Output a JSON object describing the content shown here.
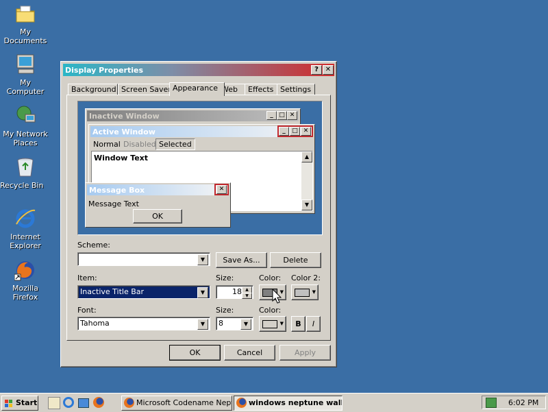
{
  "desktop": {
    "icons": [
      {
        "label": "My Documents"
      },
      {
        "label": "My Computer"
      },
      {
        "label": "My Network Places"
      },
      {
        "label": "Recycle Bin"
      },
      {
        "label": "Internet Explorer"
      },
      {
        "label": "Mozilla Firefox"
      }
    ]
  },
  "dialog": {
    "title": "Display Properties",
    "help_btn": "?",
    "close_btn": "✕",
    "tabs": [
      "Background",
      "Screen Saver",
      "Appearance",
      "Web",
      "Effects",
      "Settings"
    ],
    "active_tab": "Appearance",
    "preview": {
      "inactive_title": "Inactive Window",
      "active_title": "Active Window",
      "menu": [
        "Normal",
        "Disabled",
        "Selected"
      ],
      "window_text": "Window Text",
      "msgbox_title": "Message Box",
      "msgbox_text": "Message Text",
      "ok": "OK"
    },
    "scheme_label": "Scheme:",
    "scheme_value": "",
    "save_as": "Save As...",
    "delete": "Delete",
    "item_label": "Item:",
    "item_value": "Inactive Title Bar",
    "size_label": "Size:",
    "size_value": "18",
    "color_label": "Color:",
    "color2_label": "Color 2:",
    "font_label": "Font:",
    "font_value": "Tahoma",
    "font_size_label": "Size:",
    "font_size_value": "8",
    "font_color_label": "Color:",
    "bold": "B",
    "italic": "I",
    "ok": "OK",
    "cancel": "Cancel",
    "apply": "Apply"
  },
  "taskbar": {
    "start": "Start",
    "tasks": [
      "Microsoft Codename Nept...",
      "windows neptune wall..."
    ],
    "clock": "6:02 PM"
  },
  "colors": {
    "desktop": "#3a6ea5",
    "face": "#d4d0c8",
    "selection": "#0a246a",
    "highlight_border": "#c0282d"
  }
}
